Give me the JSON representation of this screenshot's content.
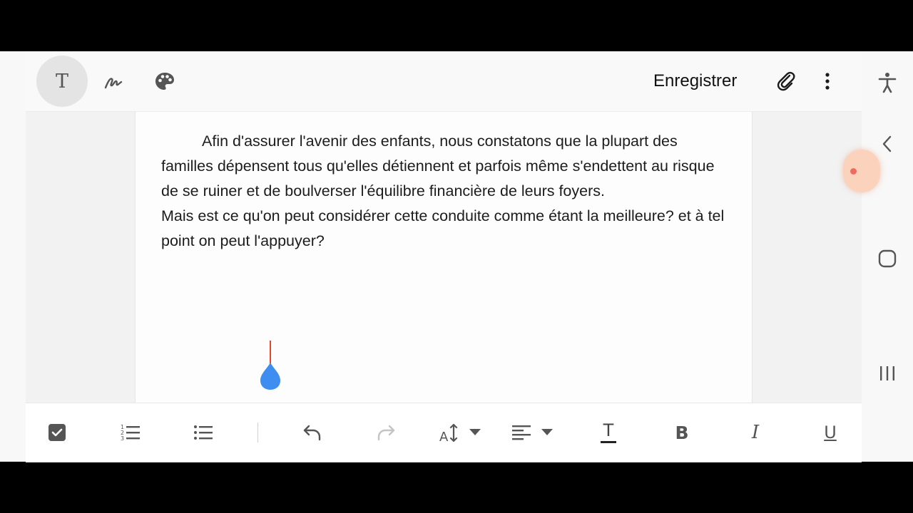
{
  "toolbar": {
    "save_label": "Enregistrer",
    "text_mode_glyph": "T",
    "modes": [
      "text-icon",
      "pen-icon",
      "palette-icon"
    ],
    "actions": [
      "paperclip-icon",
      "more-vert-icon"
    ]
  },
  "document": {
    "paragraphs": [
      "Afin d'assurer l'avenir des enfants, nous constatons que la plupart des familles dépensent tous qu'elles détiennent et parfois même s'endettent au risque de se ruiner et de boulverser l'équilibre financière de leurs foyers.",
      "Mais est ce qu'on peut considérer cette conduite comme étant la meilleure? et à tel point on peut l'appuyer?"
    ]
  },
  "format_bar": {
    "tools": [
      "checkbox-icon",
      "numbered-list-icon",
      "bulleted-list-icon",
      "undo-icon",
      "redo-icon",
      "text-size-icon",
      "align-left-icon",
      "text-color-icon",
      "bold-icon",
      "italic-icon",
      "underline-icon"
    ],
    "bold_glyph": "B",
    "italic_glyph": "I",
    "underline_glyph": "U",
    "text_color_glyph": "T",
    "text_size_glyph": "A"
  },
  "system_nav": [
    "accessibility-icon",
    "back-icon",
    "home-icon",
    "recents-icon"
  ],
  "colors": {
    "cursor": "#e2492b",
    "cursor_handle": "#3d8ef0",
    "floating_button": "#fbd3bd"
  }
}
